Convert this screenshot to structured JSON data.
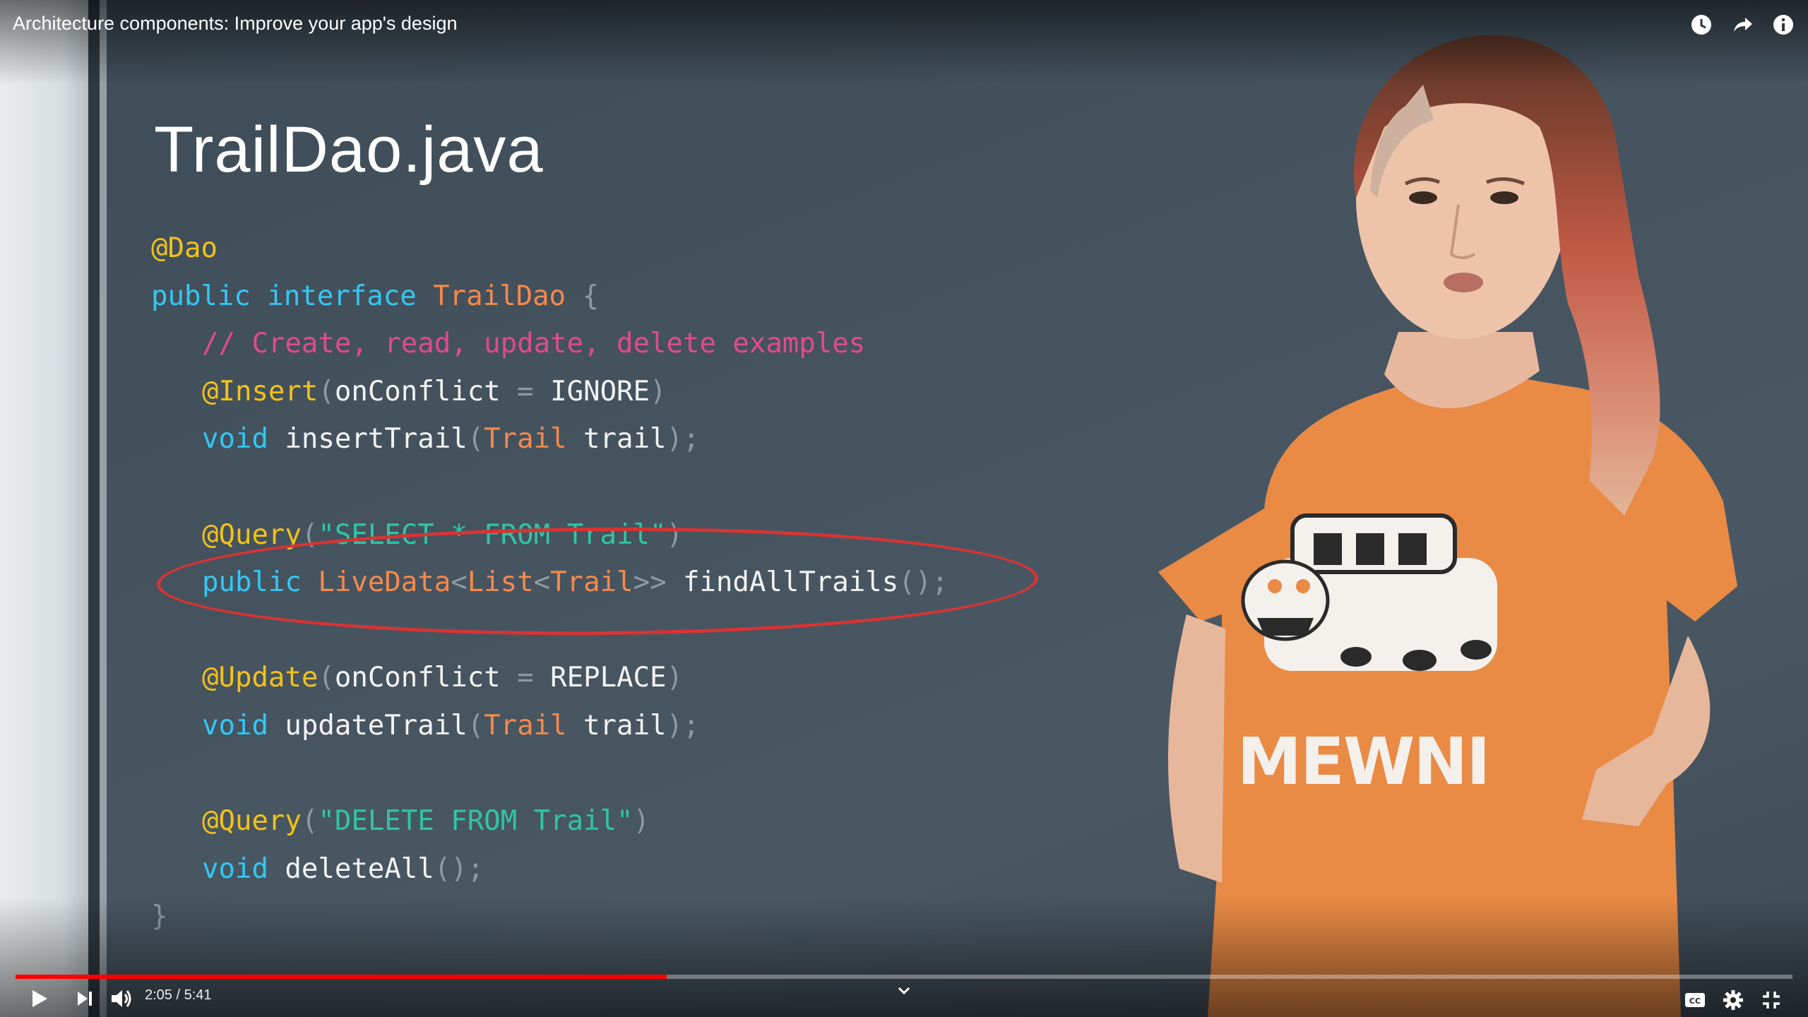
{
  "video": {
    "title": "Architecture components: Improve your app's design",
    "time_display": "2:05 / 5:41",
    "progress_fraction": 0.3666
  },
  "top_icons": [
    "watch-later-icon",
    "share-icon",
    "info-icon"
  ],
  "slide": {
    "title": "TrailDao.java",
    "code_lines": [
      {
        "indent": 0,
        "tokens": [
          {
            "t": "@Dao",
            "c": "ann"
          }
        ]
      },
      {
        "indent": 0,
        "tokens": [
          {
            "t": "public interface ",
            "c": "kw"
          },
          {
            "t": "TrailDao",
            "c": "cls"
          },
          {
            "t": " {",
            "c": "pun"
          }
        ]
      },
      {
        "indent": 1,
        "tokens": [
          {
            "t": "// Create, read, update, delete examples",
            "c": "cm"
          }
        ]
      },
      {
        "indent": 1,
        "tokens": [
          {
            "t": "@Insert",
            "c": "ann"
          },
          {
            "t": "(",
            "c": "pun"
          },
          {
            "t": "onConflict",
            "c": "plain"
          },
          {
            "t": " = ",
            "c": "pun"
          },
          {
            "t": "IGNORE",
            "c": "plain"
          },
          {
            "t": ")",
            "c": "pun"
          }
        ]
      },
      {
        "indent": 1,
        "tokens": [
          {
            "t": "void ",
            "c": "kw"
          },
          {
            "t": "insertTrail",
            "c": "plain"
          },
          {
            "t": "(",
            "c": "pun"
          },
          {
            "t": "Trail",
            "c": "cls"
          },
          {
            "t": " trail",
            "c": "plain"
          },
          {
            "t": ");",
            "c": "pun"
          }
        ]
      },
      {
        "indent": 0,
        "tokens": []
      },
      {
        "indent": 1,
        "tokens": [
          {
            "t": "@Query",
            "c": "ann"
          },
          {
            "t": "(",
            "c": "pun"
          },
          {
            "t": "\"SELECT * FROM Trail\"",
            "c": "str"
          },
          {
            "t": ")",
            "c": "pun"
          }
        ]
      },
      {
        "indent": 1,
        "tokens": [
          {
            "t": "public ",
            "c": "kw"
          },
          {
            "t": "LiveData",
            "c": "cls"
          },
          {
            "t": "<",
            "c": "pun"
          },
          {
            "t": "List",
            "c": "cls"
          },
          {
            "t": "<",
            "c": "pun"
          },
          {
            "t": "Trail",
            "c": "cls"
          },
          {
            "t": ">>",
            "c": "pun"
          },
          {
            "t": " findAllTrails",
            "c": "plain"
          },
          {
            "t": "();",
            "c": "pun"
          }
        ]
      },
      {
        "indent": 0,
        "tokens": []
      },
      {
        "indent": 1,
        "tokens": [
          {
            "t": "@Update",
            "c": "ann"
          },
          {
            "t": "(",
            "c": "pun"
          },
          {
            "t": "onConflict",
            "c": "plain"
          },
          {
            "t": " = ",
            "c": "pun"
          },
          {
            "t": "REPLACE",
            "c": "plain"
          },
          {
            "t": ")",
            "c": "pun"
          }
        ]
      },
      {
        "indent": 1,
        "tokens": [
          {
            "t": "void ",
            "c": "kw"
          },
          {
            "t": "updateTrail",
            "c": "plain"
          },
          {
            "t": "(",
            "c": "pun"
          },
          {
            "t": "Trail",
            "c": "cls"
          },
          {
            "t": " trail",
            "c": "plain"
          },
          {
            "t": ");",
            "c": "pun"
          }
        ]
      },
      {
        "indent": 0,
        "tokens": []
      },
      {
        "indent": 1,
        "tokens": [
          {
            "t": "@Query",
            "c": "ann"
          },
          {
            "t": "(",
            "c": "pun"
          },
          {
            "t": "\"DELETE FROM Trail\"",
            "c": "str"
          },
          {
            "t": ")",
            "c": "pun"
          }
        ]
      },
      {
        "indent": 1,
        "tokens": [
          {
            "t": "void ",
            "c": "kw"
          },
          {
            "t": "deleteAll",
            "c": "plain"
          },
          {
            "t": "();",
            "c": "pun"
          }
        ]
      },
      {
        "indent": 0,
        "tokens": [
          {
            "t": "}",
            "c": "pun"
          }
        ]
      }
    ]
  },
  "shirt_text": "MEWNI",
  "colors": {
    "progress_played": "#ff0000",
    "highlight_ellipse": "#d93333",
    "shirt": "#e98a45"
  },
  "controls": {
    "left": [
      "play-icon",
      "next-icon",
      "volume-icon"
    ],
    "right": [
      "captions-icon",
      "settings-icon",
      "exit-fullscreen-icon"
    ]
  }
}
